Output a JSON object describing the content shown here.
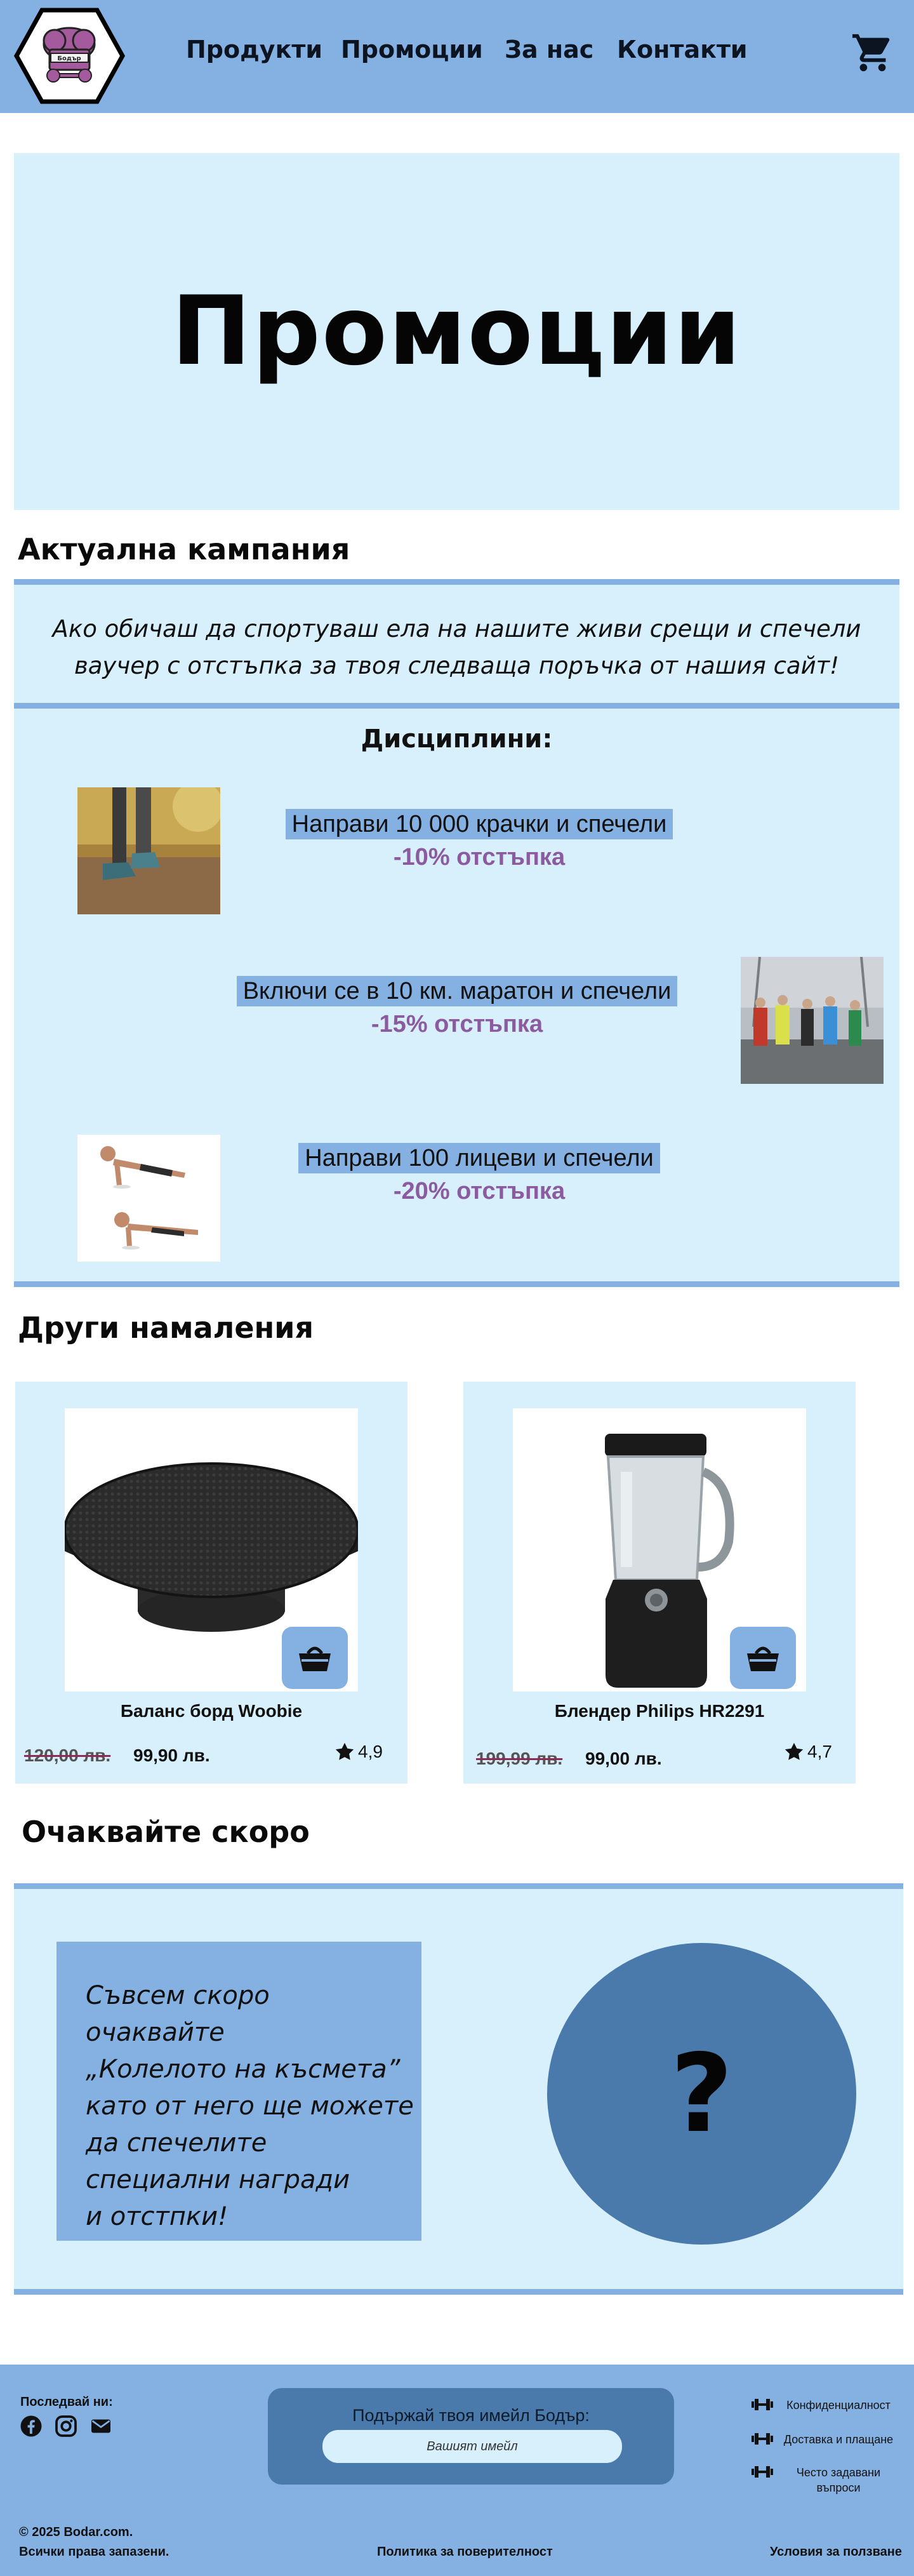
{
  "header": {
    "logo_text": "Бодър",
    "nav": [
      "Продукти",
      "Промоции",
      "За нас",
      "Контакти"
    ]
  },
  "hero": {
    "title": "Промоции"
  },
  "campaign": {
    "heading": "Актуална кампания",
    "intro_line1": "Ако обичаш да спортуваш ела на нашите живи срещи и спечели",
    "intro_line2": "ваучер с отстъпка за твоя следваща поръчка от нашия сайт!",
    "disciplines_title": "Дисциплини:",
    "tasks": [
      {
        "label": "Направи 10 000 крачки и спечели",
        "discount": "-10% отстъпка"
      },
      {
        "label": "Включи се в 10 км. маратон и спечели",
        "discount": "-15% отстъпка"
      },
      {
        "label": "Направи 100 лицеви и спечели",
        "discount": "-20% отстъпка"
      }
    ]
  },
  "offers": {
    "heading": "Други намаления",
    "products": [
      {
        "name": "Баланс борд Woobie",
        "old_price": "120,00 лв.",
        "new_price": "99,90 лв.",
        "rating": "4,9"
      },
      {
        "name": "Блендер Philips HR2291",
        "old_price": "199,99 лв.",
        "new_price": "99,00 лв.",
        "rating": "4,7"
      }
    ]
  },
  "coming_soon": {
    "heading": "Очаквайте скоро",
    "text": "Съвсем скоро очаквайте\n„Колелото на късмета”\nкато от него ще можете\nда спечелите\nспециални награди\nи отстпки!",
    "wheel_symbol": "?"
  },
  "footer": {
    "follow_label": "Последвай ни:",
    "newsletter_label": "Подържай твоя имейл Бодър:",
    "email_placeholder": "Вашият имейл",
    "links": [
      "Конфиденциалност",
      "Доставка и плащане",
      "Често задавани въпроси"
    ],
    "copyright_line1": "© 2025 Bodar.com.",
    "copyright_line2": "Всички права запазени.",
    "privacy_policy": "Политика за поверителност",
    "terms": "Условия за ползване"
  },
  "colors": {
    "brand_blue": "#84b1e1",
    "light_blue": "#d8f0fc",
    "dark_blue": "#4a7aab",
    "discount_purple": "#8b5a9f"
  }
}
